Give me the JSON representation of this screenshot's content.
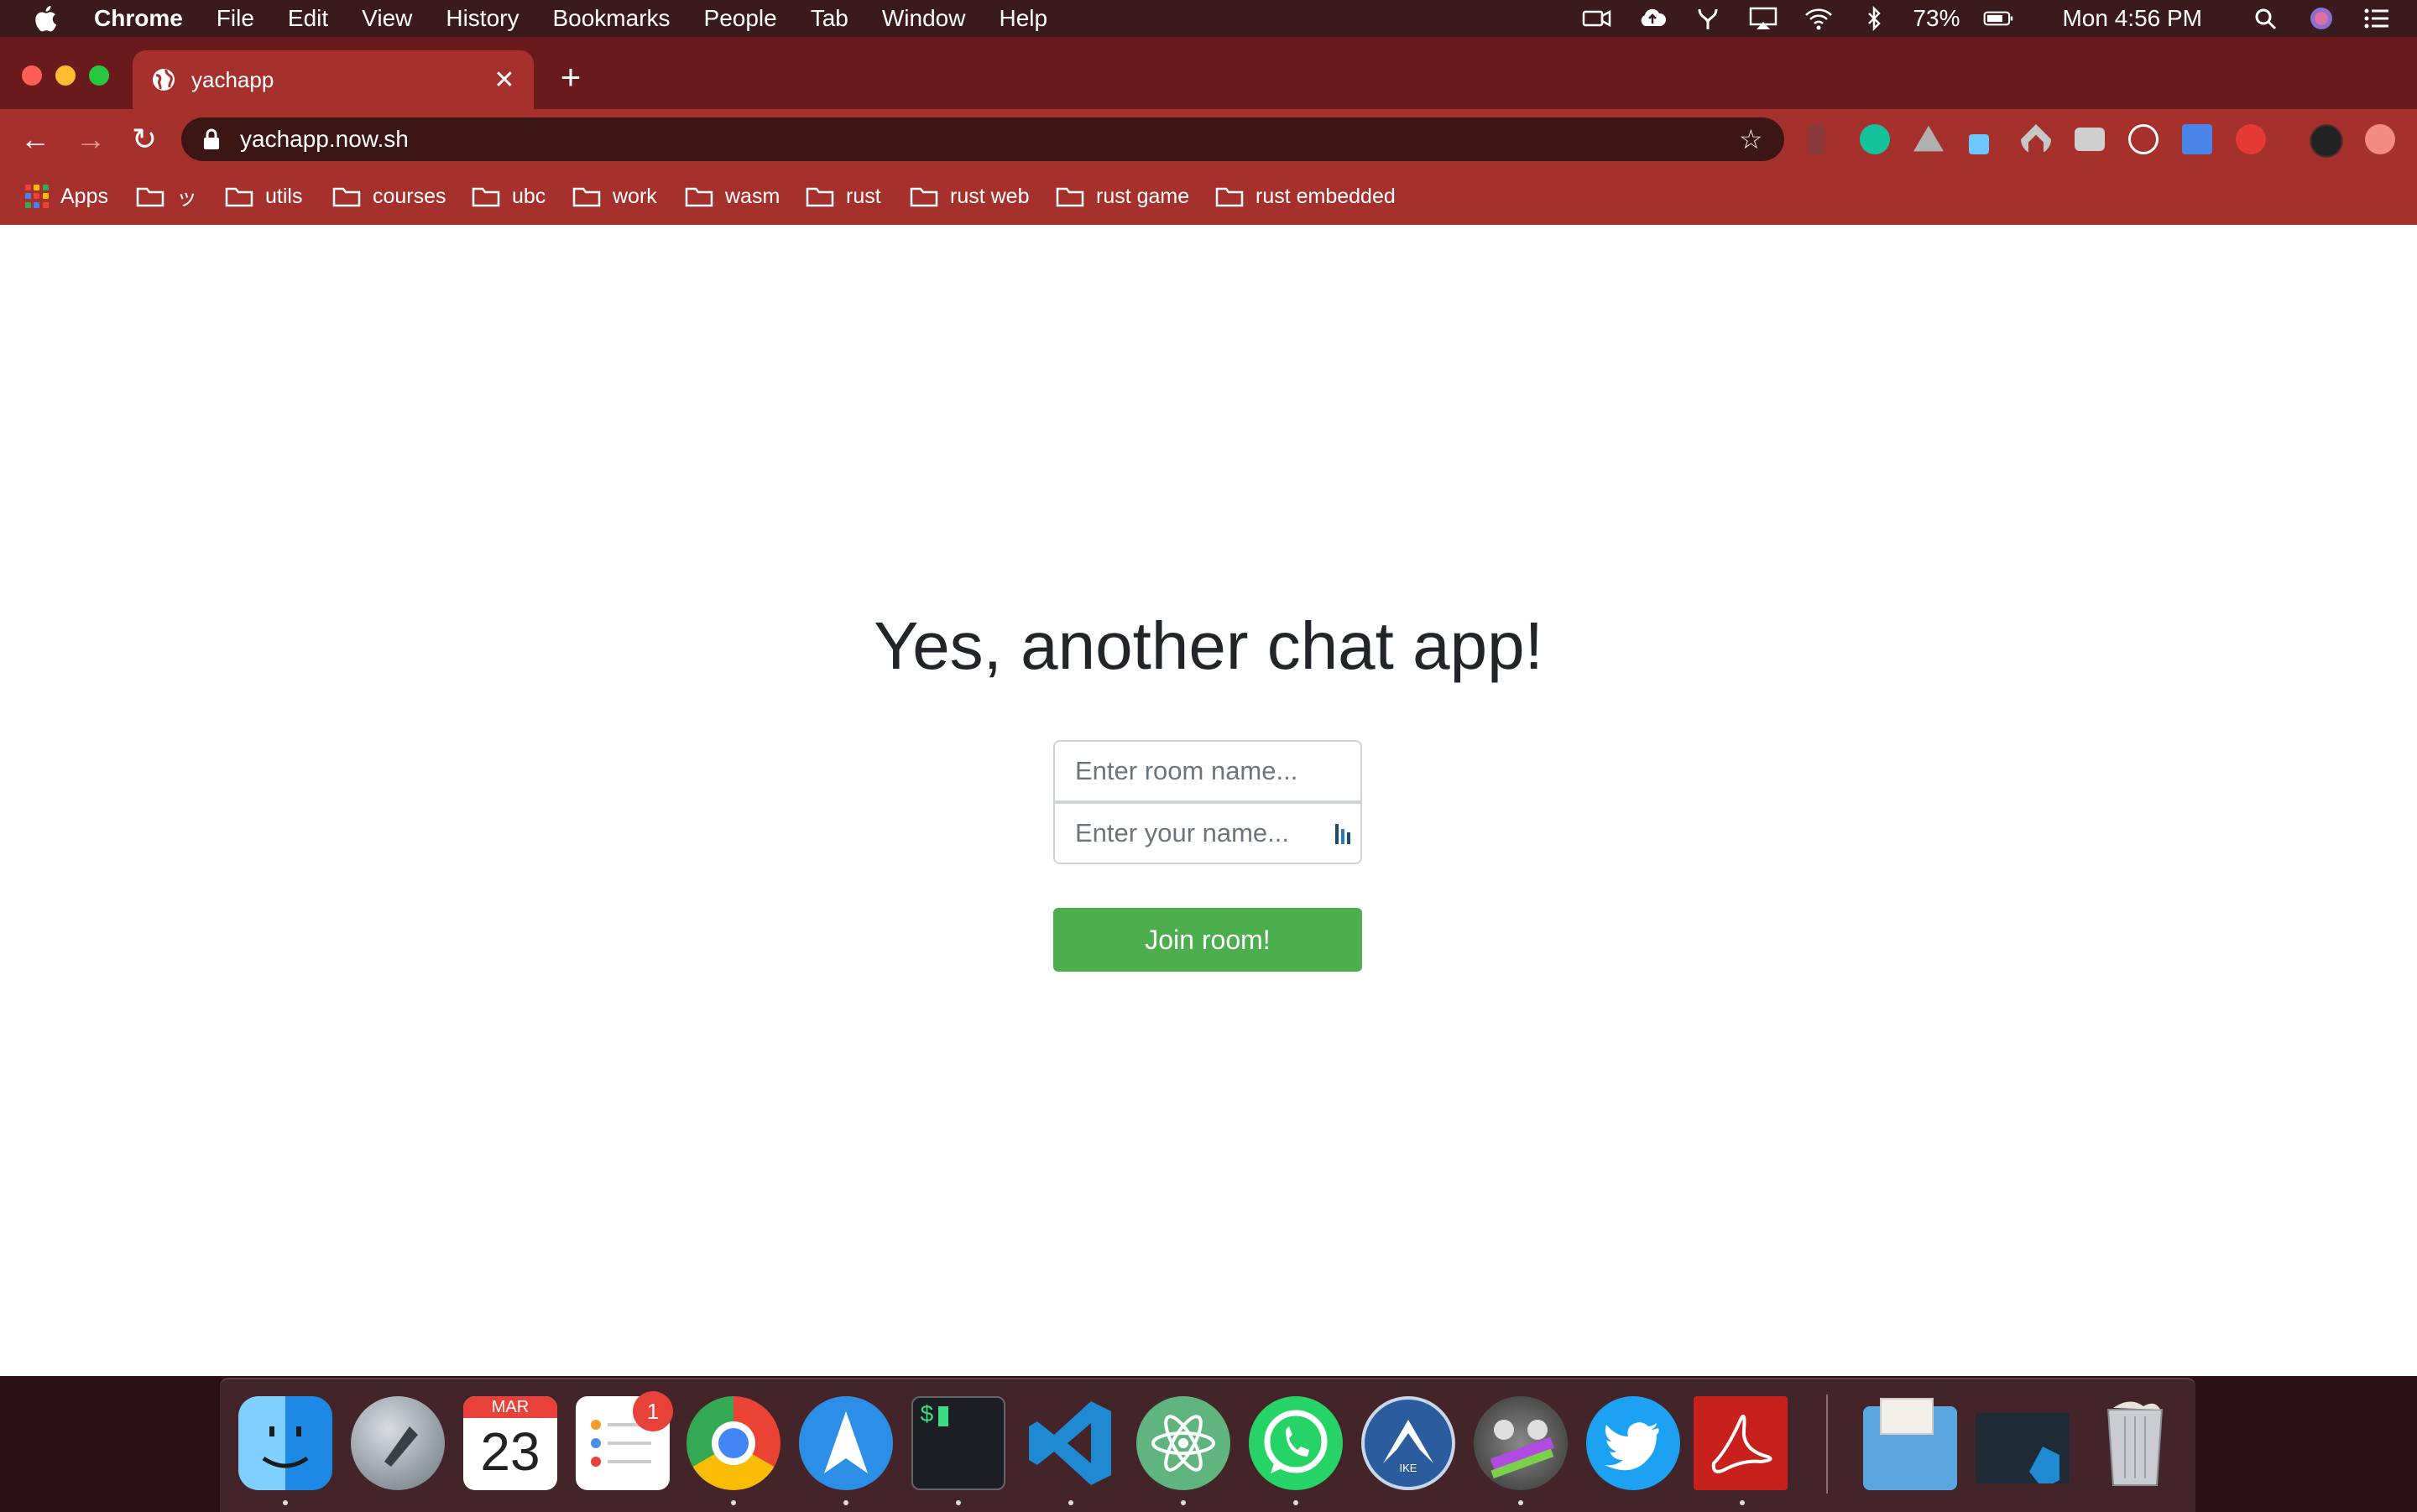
{
  "menubar": {
    "app_name": "Chrome",
    "items": [
      "File",
      "Edit",
      "View",
      "History",
      "Bookmarks",
      "People",
      "Tab",
      "Window",
      "Help"
    ],
    "battery": "73%",
    "clock": "Mon 4:56 PM"
  },
  "browser": {
    "tab_title": "yachapp",
    "url": "yachapp.now.sh",
    "tab_close": "✕",
    "new_tab": "+",
    "back": "←",
    "forward": "→",
    "reload": "↻",
    "star": "☆"
  },
  "bookmarks": [
    {
      "label": "Apps"
    },
    {
      "label": "ッ"
    },
    {
      "label": "utils"
    },
    {
      "label": "courses"
    },
    {
      "label": "ubc"
    },
    {
      "label": "work"
    },
    {
      "label": "wasm"
    },
    {
      "label": "rust"
    },
    {
      "label": "rust web"
    },
    {
      "label": "rust game"
    },
    {
      "label": "rust embedded"
    }
  ],
  "page": {
    "heading": "Yes, another chat app!",
    "room_placeholder": "Enter room name...",
    "name_placeholder": "Enter your name...",
    "join_label": "Join room!"
  },
  "dock": {
    "calendar_month": "MAR",
    "calendar_day": "23",
    "reminders_badge": "1",
    "terminal_prompt": "$",
    "nordvpn_label": "IKE"
  },
  "colors": {
    "join_button": "#4cae4c",
    "toolbar": "#a5302c",
    "tabstrip": "#6b1a1c"
  }
}
